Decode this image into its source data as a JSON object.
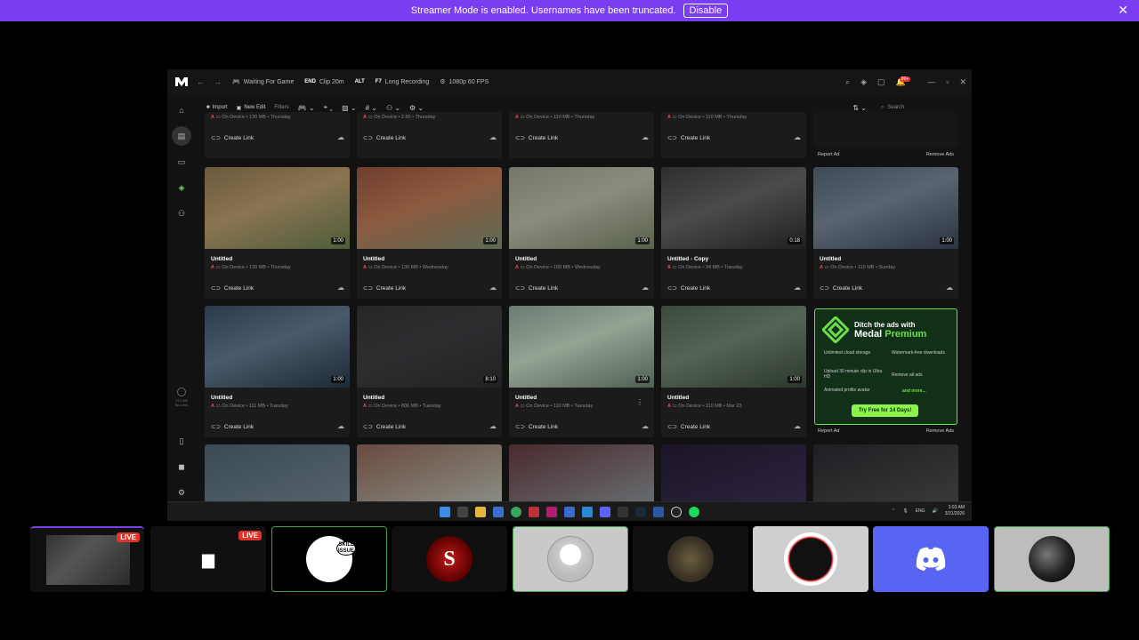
{
  "banner": {
    "message": "Streamer Mode is enabled. Usernames have been truncated.",
    "disable_label": "Disable",
    "close_icon": "close-icon"
  },
  "app": {
    "status": "Waiting For Game",
    "hotkeys": [
      {
        "key": "END",
        "label": "Clip 20m"
      },
      {
        "key": "ALT",
        "label": ""
      },
      {
        "key": "F7",
        "label": "Long Recording"
      }
    ],
    "quality": "1080p 60 FPS",
    "notification_count": "99+",
    "toolbar": {
      "import_label": "Import",
      "new_edit_label": "New Edit",
      "filters_label": "Filters",
      "search_placeholder": "Search"
    },
    "storage": {
      "used": "372 GB",
      "limit": "No Limit"
    },
    "top_row": {
      "meta": [
        "On Device • 130 MB • Thursday",
        "On Device • 2.60 • Thursday",
        "On Device • 110 MB • Thursday",
        "On Device • 110 MB • Thursday"
      ],
      "link_label": "Create Link"
    },
    "clips_row1": [
      {
        "title": "Untitled",
        "meta": "On Device • 130 MB • Thursday",
        "duration": "1:00",
        "link": "Create Link",
        "colors": [
          "#6b5a3c",
          "#8a7451",
          "#4e5d3a"
        ]
      },
      {
        "title": "Untitled",
        "meta": "On Device • 130 MB • Wednesday",
        "duration": "1:00",
        "link": "Create Link",
        "colors": [
          "#6e3f2c",
          "#8c5a3f",
          "#5d6a54"
        ]
      },
      {
        "title": "Untitled",
        "meta": "On Device • 109 MB • Wednesday",
        "duration": "1:00",
        "link": "Create Link",
        "colors": [
          "#75776a",
          "#8b8c7d",
          "#5a614e"
        ]
      },
      {
        "title": "Untitled - Copy",
        "meta": "On Device • 34 MB • Tuesday",
        "duration": "0:18",
        "link": "Create Link",
        "colors": [
          "#2c2e2f",
          "#4a4b4d",
          "#1e2021"
        ]
      },
      {
        "title": "Untitled",
        "meta": "On Device • 110 MB • Sunday",
        "duration": "1:00",
        "link": "Create Link",
        "colors": [
          "#3d4a57",
          "#596470",
          "#2b3440"
        ]
      }
    ],
    "clips_row2": [
      {
        "title": "Untitled",
        "meta": "On Device • 111 MB • Tuesday",
        "duration": "1:00",
        "link": "Create Link",
        "colors": [
          "#2b3a4d",
          "#4a5a6a",
          "#1d2a36"
        ]
      },
      {
        "title": "Untitled",
        "meta": "On Device • 806 MB • Tuesday",
        "duration": "8:10",
        "link": "Create Link",
        "colors": [
          "#262628",
          "#2e2e31",
          "#222224"
        ]
      },
      {
        "title": "Untitled",
        "meta": "On Device • 110 MB • Tuesday",
        "duration": "1:00",
        "link": "Create Link",
        "colors": [
          "#6c7a72",
          "#94a392",
          "#4f5f52"
        ]
      },
      {
        "title": "Untitled",
        "meta": "On Device • 110 MB • Mar 23",
        "duration": "1:00",
        "link": "Create Link",
        "colors": [
          "#3b4a3a",
          "#556455",
          "#2b372c"
        ]
      }
    ],
    "clips_row3_colors": [
      [
        "#3b4a54",
        "#56636b"
      ],
      [
        "#6a4a3f",
        "#8a8f86"
      ],
      [
        "#4a2a2e",
        "#686f72"
      ],
      [
        "#1c1426",
        "#2c2440"
      ],
      [
        "#1d1f22",
        "#3a3a3a"
      ]
    ],
    "ad": {
      "line1": "Ditch the ads with",
      "line2_a": "Medal",
      "line2_b": "Premium",
      "features": [
        "Unlimited cloud storage",
        "Watermark-free downloads",
        "Upload 30 minute clip in Ultra HD",
        "Remove all ads",
        "Animated profile avatar",
        "and more..."
      ],
      "cta": "Try Free for 14 Days!",
      "report_label": "Report Ad",
      "remove_label": "Remove Ads"
    },
    "taskbar_clock": {
      "time": "3:03 AM",
      "date": "3/31/2026",
      "lang": "ENG"
    }
  },
  "participants": [
    {
      "label": "LIVE",
      "type": "stream-preview"
    },
    {
      "label": "LIVE",
      "type": "screen-share"
    },
    {
      "label": "SKILL ISSUE",
      "type": "avatar",
      "bg": "#000000",
      "border": "#3ea34b"
    },
    {
      "label": "",
      "type": "avatar",
      "bg": "#0f0f0f"
    },
    {
      "label": "",
      "type": "avatar",
      "bg": "#c9c9c9",
      "border": "#3ea34b"
    },
    {
      "label": "",
      "type": "avatar",
      "bg": "#101010"
    },
    {
      "label": "",
      "type": "avatar",
      "bg": "#cfcfcf"
    },
    {
      "label": "",
      "type": "discord",
      "bg": "#5865f2"
    },
    {
      "label": "",
      "type": "avatar",
      "bg": "#bdbdbd",
      "border": "#3ea34b"
    }
  ]
}
